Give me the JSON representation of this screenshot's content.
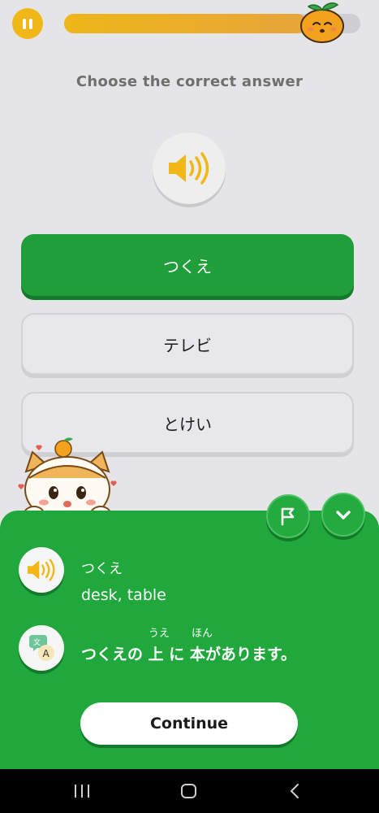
{
  "header": {
    "progress": 0.82
  },
  "prompt": "Choose the correct answer",
  "options": [
    {
      "label": "つくえ",
      "state": "correct"
    },
    {
      "label": "テレビ",
      "state": "neutral"
    },
    {
      "label": "とけい",
      "state": "neutral"
    }
  ],
  "feedback": {
    "word_kana": "つくえ",
    "word_meaning": "desk, table",
    "example": {
      "ruby_ue": "うえ",
      "ruby_hon": "ほん",
      "part1": "つくえの",
      "kanji1": "上",
      "part2": "に",
      "kanji2": "本",
      "part3": "があります。"
    },
    "continue_label": "Continue"
  },
  "colors": {
    "accent_orange": "#f0b716",
    "correct_green": "#21a83c",
    "background": "#e5e4e6"
  },
  "icons": {
    "pause": "pause-icon",
    "speaker": "speaker-icon",
    "flag": "flag-icon",
    "collapse": "chevron-down-icon",
    "translate": "translate-icon",
    "nav_recent": "recent-apps-icon",
    "nav_home": "home-icon",
    "nav_back": "back-icon"
  }
}
